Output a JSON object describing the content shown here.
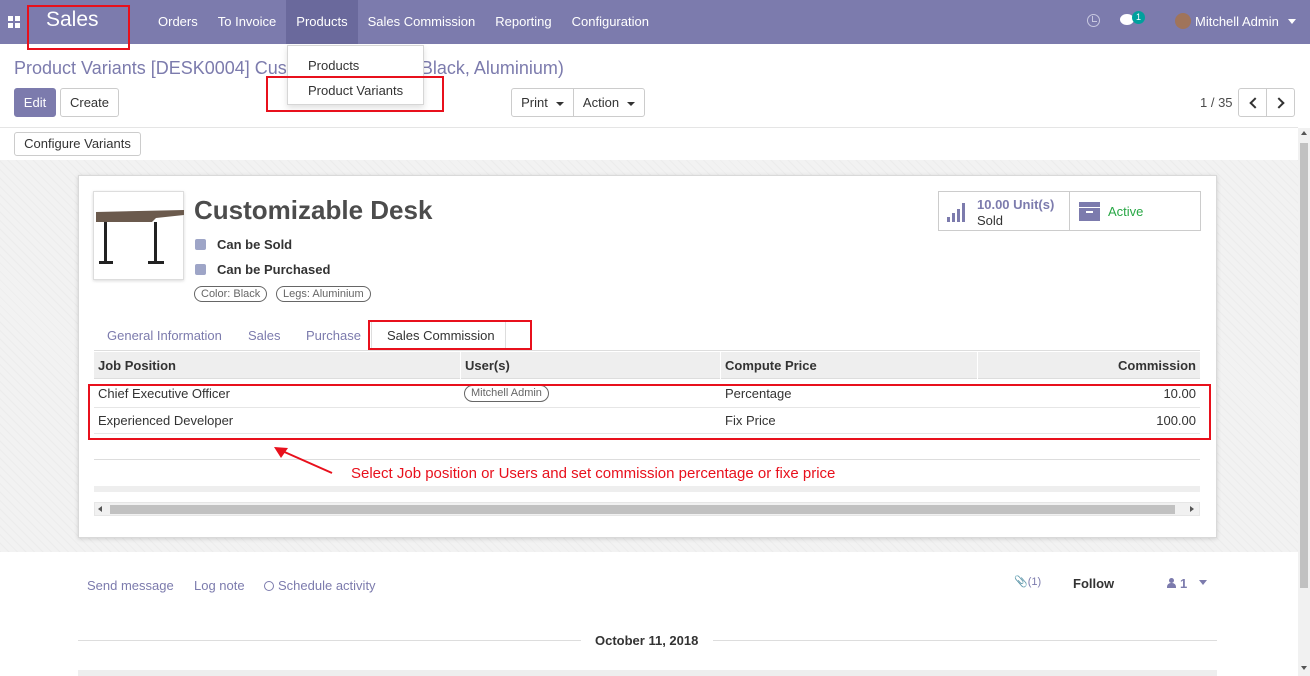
{
  "navbar": {
    "brand": "Sales",
    "menu": [
      "Orders",
      "To Invoice",
      "Products",
      "Sales Commission",
      "Reporting",
      "Configuration"
    ],
    "active_menu": "Products",
    "message_count": "1",
    "user_name": "Mitchell Admin",
    "accent_color": "#7c7bad"
  },
  "products_dropdown": {
    "items": [
      "Products",
      "Product Variants"
    ]
  },
  "control_panel": {
    "breadcrumb": "Product Variants [DESK0004] Customizable Desk (Black, Aluminium)",
    "edit_label": "Edit",
    "create_label": "Create",
    "print_label": "Print",
    "action_label": "Action",
    "pager": "1 / 35",
    "configure_variants_label": "Configure Variants"
  },
  "record": {
    "name": "Customizable Desk",
    "can_be_sold_label": "Can be Sold",
    "can_be_sold": true,
    "can_be_purchased_label": "Can be Purchased",
    "can_be_purchased": true,
    "attribute_tags": [
      "Color: Black",
      "Legs: Aluminium"
    ],
    "sold_value": "10.00 Unit(s)",
    "sold_label": "Sold",
    "active_label": "Active"
  },
  "tabs": [
    "General Information",
    "Sales",
    "Purchase",
    "Sales Commission"
  ],
  "active_tab": "Sales Commission",
  "commission_table": {
    "columns": [
      "Job Position",
      "User(s)",
      "Compute Price",
      "Commission"
    ],
    "rows": [
      {
        "job_position": "Chief Executive Officer",
        "users": "Mitchell Admin",
        "compute_price": "Percentage",
        "commission": "10.00"
      },
      {
        "job_position": "Experienced Developer",
        "users": "",
        "compute_price": "Fix Price",
        "commission": "100.00"
      }
    ]
  },
  "annotation": "Select Job position or Users and set commission percentage or fixe price",
  "chatter": {
    "send_message": "Send message",
    "log_note": "Log note",
    "schedule_activity": "Schedule activity",
    "attachments": "(1)",
    "follow": "Follow",
    "followers": "1",
    "date": "October 11, 2018"
  }
}
